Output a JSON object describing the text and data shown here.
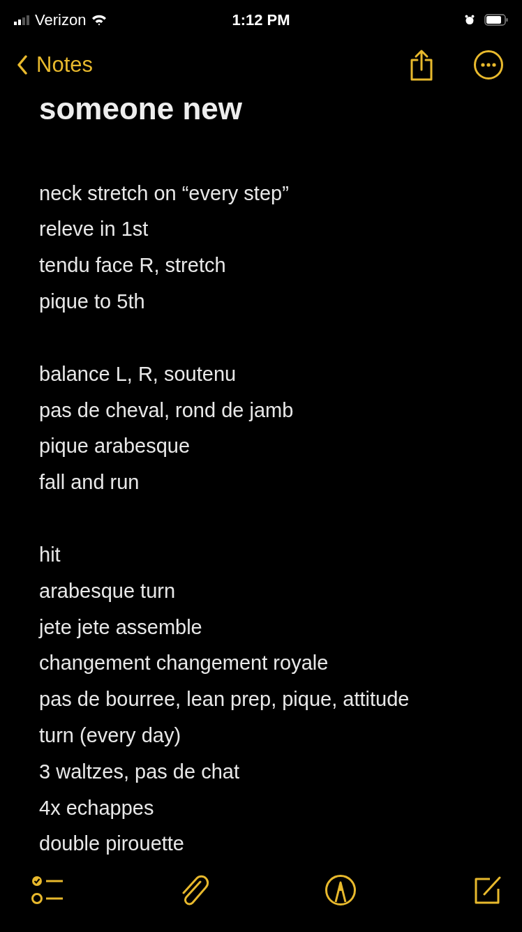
{
  "status_bar": {
    "carrier": "Verizon",
    "time": "1:12 PM"
  },
  "nav": {
    "back_label": "Notes"
  },
  "note": {
    "title": "someone new",
    "paragraphs": [
      {
        "lines": [
          "neck stretch on “every step”",
          "releve in 1st",
          "tendu face R, stretch",
          "pique to 5th"
        ]
      },
      {
        "lines": [
          "balance L, R, soutenu",
          "pas de cheval, rond de jamb",
          "pique arabesque",
          "fall and run"
        ]
      },
      {
        "lines": [
          "hit",
          "arabesque turn",
          "jete jete assemble",
          "changement changement royale",
          "pas de bourree, lean prep, pique, attitude",
          "turn (every day)",
          "3 waltzes, pas de chat",
          "4x echappes",
          "double pirouette"
        ]
      }
    ]
  }
}
